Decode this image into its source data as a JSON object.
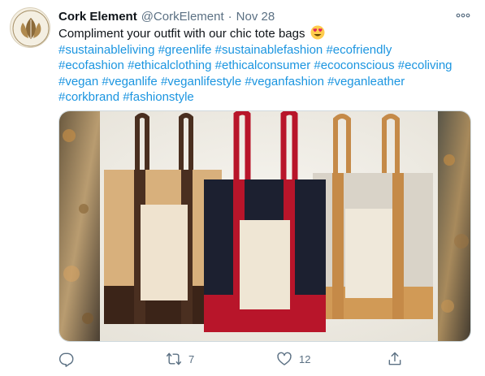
{
  "tweet": {
    "author_name": "Cork Element",
    "author_handle": "@CorkElement",
    "separator": "·",
    "date": "Nov 28",
    "text": "Compliment your outfit with our chic tote bags",
    "emoji": "heart-eyes-emoji",
    "hashtags": [
      "#sustainableliving",
      "#greenlife",
      "#sustainablefashion",
      "#ecofriendly",
      "#ecofashion",
      "#ethicalclothing",
      "#ethicalconsumer",
      "#ecoconscious",
      "#ecoliving",
      "#vegan",
      "#veganlife",
      "#veganlifestyle",
      "#veganfashion",
      "#veganleather",
      "#corkbrand",
      "#fashionstyle"
    ]
  },
  "media": {
    "description_icon": "three-cork-tote-bags-photo"
  },
  "actions": {
    "reply_count": "",
    "retweet_count": "7",
    "like_count": "12",
    "share_count": ""
  },
  "colors": {
    "link": "#1b95e0",
    "muted": "#5b7083",
    "text": "#0f1419"
  }
}
